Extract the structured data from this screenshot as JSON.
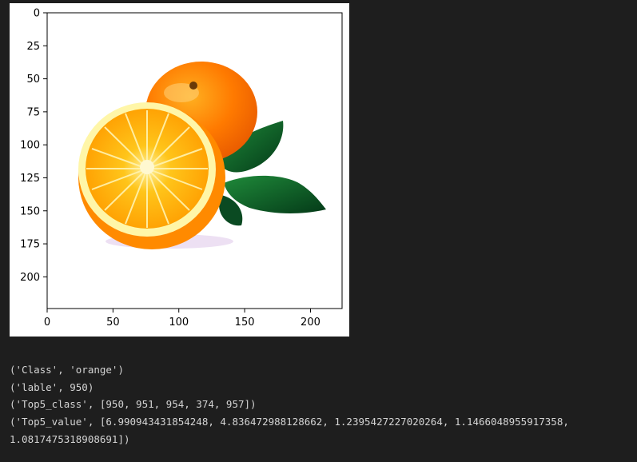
{
  "plot": {
    "image_subject": "orange-fruit-with-leaves",
    "x_ticks": [
      "0",
      "50",
      "100",
      "150",
      "200"
    ],
    "y_ticks": [
      "0",
      "25",
      "50",
      "75",
      "100",
      "125",
      "150",
      "175",
      "200"
    ],
    "xlim": [
      0,
      224
    ],
    "ylim": [
      224,
      0
    ],
    "colors": {
      "peel": "#ff8a00",
      "pulp": "#ffb300",
      "rind": "#fff6a8",
      "leaf": "#0b5a2a",
      "background": "#ffffff"
    }
  },
  "output": {
    "lines": [
      "('Class', 'orange')",
      "('lable', 950)",
      "('Top5_class', [950, 951, 954, 374, 957])",
      "('Top5_value', [6.990943431854248, 4.836472988128662, 1.2395427227020264, 1.1466048955917358,",
      "1.0817475318908691])"
    ]
  }
}
